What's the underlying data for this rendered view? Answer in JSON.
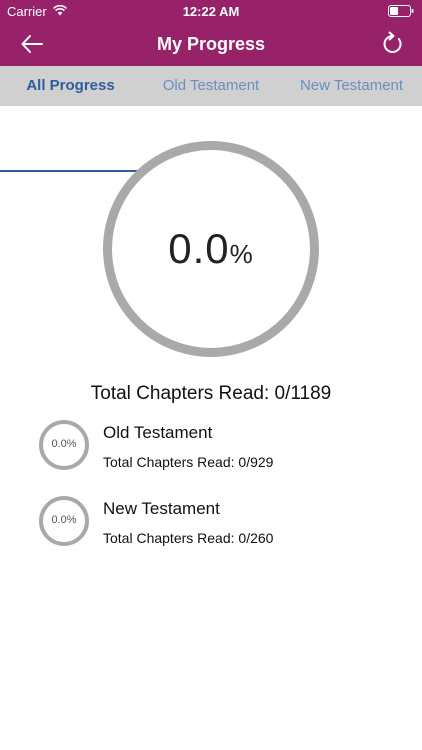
{
  "status_bar": {
    "carrier": "Carrier",
    "time": "12:22 AM"
  },
  "nav": {
    "title": "My Progress",
    "back_icon": "arrow-left-icon",
    "refresh_icon": "refresh-icon"
  },
  "tabs": [
    {
      "label": "All Progress",
      "active": true
    },
    {
      "label": "Old Testament",
      "active": false
    },
    {
      "label": "New Testament",
      "active": false
    }
  ],
  "overall": {
    "value": "0.0",
    "unit": "%",
    "progress_fraction": 0.0,
    "total_text": "Total Chapters Read: 0/1189"
  },
  "sections": [
    {
      "title": "Old Testament",
      "value": "0.0%",
      "progress_fraction": 0.0,
      "total_text": "Total Chapters Read: 0/929"
    },
    {
      "title": "New Testament",
      "value": "0.0%",
      "progress_fraction": 0.0,
      "total_text": "Total Chapters Read: 0/260"
    }
  ],
  "colors": {
    "header": "#98226a",
    "tab_bg": "#d0d0d0",
    "tab_active": "#2d5da0",
    "tab_inactive": "#6b8fbf",
    "ring": "#a9a9a9"
  }
}
